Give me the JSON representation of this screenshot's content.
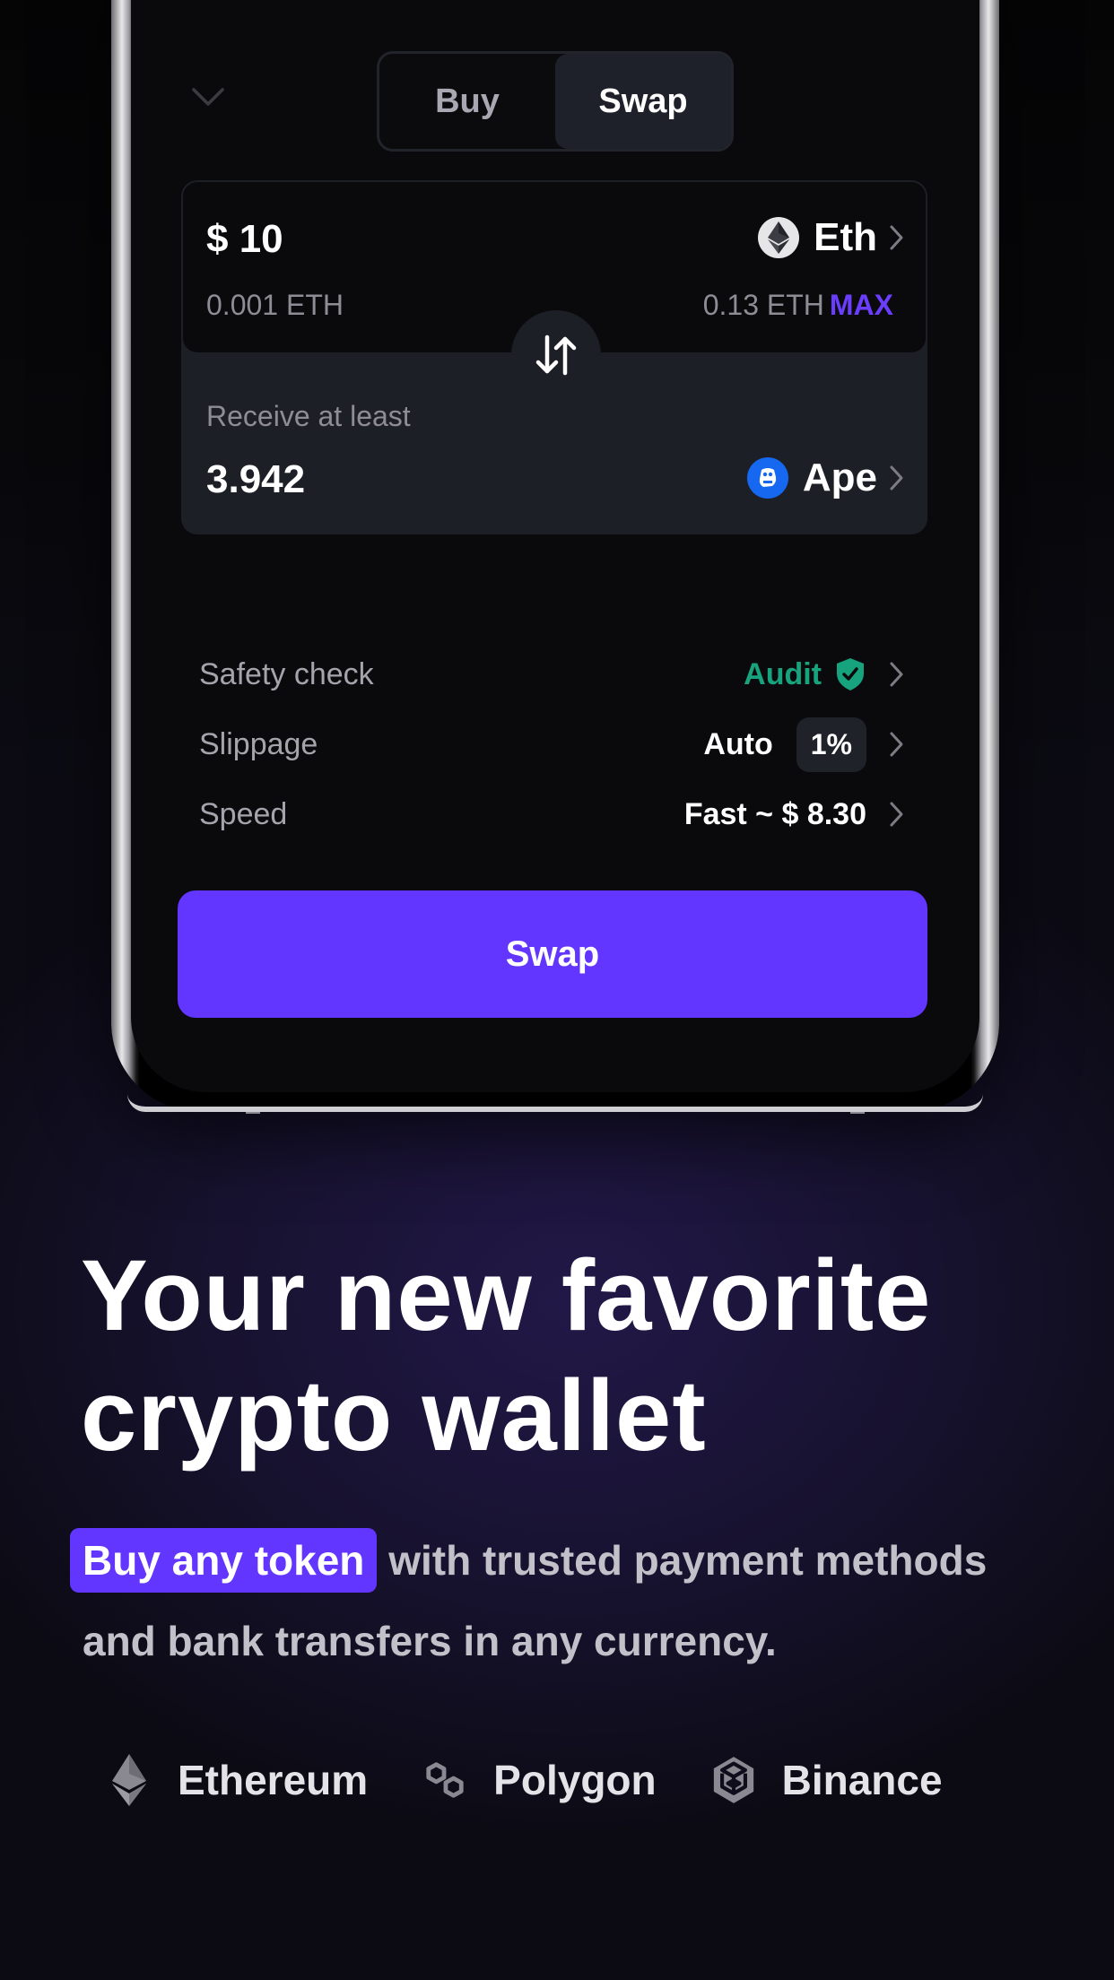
{
  "app": {
    "mode_tabs": [
      {
        "label": "Buy",
        "active": false
      },
      {
        "label": "Swap",
        "active": true
      }
    ]
  },
  "swap": {
    "from": {
      "amount": "$ 10",
      "converted": "0.001 ETH",
      "token": "Eth",
      "token_icon": "ethereum-icon",
      "balance": "0.13 ETH",
      "max_label": "MAX"
    },
    "to": {
      "label": "Receive at least",
      "amount": "3.942",
      "token": "Ape",
      "token_icon": "apecoin-icon"
    },
    "details": [
      {
        "label": "Safety check",
        "value": "Audit",
        "icon": "shield-check-icon"
      },
      {
        "label": "Slippage",
        "value": "Auto",
        "chip": "1%"
      },
      {
        "label": "Speed",
        "value": "Fast ~ $ 8.30"
      }
    ],
    "submit_label": "Swap"
  },
  "marketing": {
    "headline_line1": "Your new favorite",
    "headline_line2": "crypto wallet",
    "highlight": "Buy any token",
    "subtext": "with trusted payment methods and bank transfers in any currency."
  },
  "chains": [
    {
      "name": "Ethereum",
      "icon": "ethereum-icon"
    },
    {
      "name": "Polygon",
      "icon": "polygon-icon"
    },
    {
      "name": "Binance",
      "icon": "binance-icon"
    }
  ],
  "colors": {
    "accent": "#6236ff",
    "max": "#6a3dff",
    "audit": "#17a37d",
    "ape": "#1768f0"
  }
}
